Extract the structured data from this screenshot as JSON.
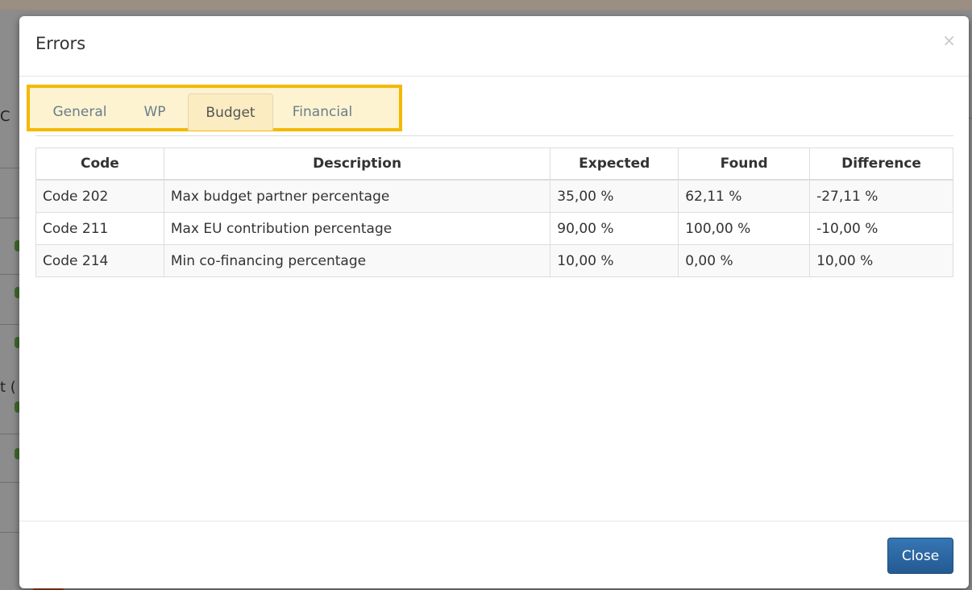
{
  "modal": {
    "title": "Errors",
    "close_icon": "×",
    "close_button_label": "Close"
  },
  "tabs": [
    {
      "label": "General",
      "active": false
    },
    {
      "label": "WP",
      "active": false
    },
    {
      "label": "Budget",
      "active": true
    },
    {
      "label": "Financial",
      "active": false
    }
  ],
  "table": {
    "headers": [
      "Code",
      "Description",
      "Expected",
      "Found",
      "Difference"
    ],
    "rows": [
      [
        "Code 202",
        "Max budget partner percentage",
        "35,00 %",
        "62,11 %",
        "-27,11 %"
      ],
      [
        "Code 211",
        "Max EU contribution percentage",
        "90,00 %",
        "100,00 %",
        "-10,00 %"
      ],
      [
        "Code 214",
        "Min co-financing percentage",
        "10,00 %",
        "0,00 %",
        "10,00 %"
      ]
    ]
  },
  "backdrop": {
    "partial_text_1": "C",
    "partial_text_2": "t ("
  },
  "colors": {
    "highlight_border": "#f5b800",
    "primary_button": "#2c6aa6"
  }
}
